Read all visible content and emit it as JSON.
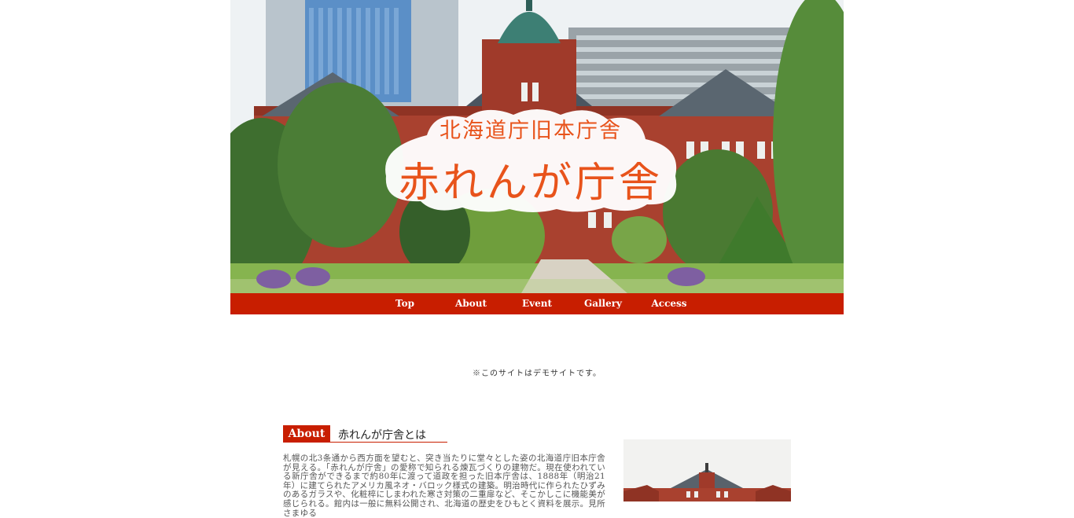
{
  "hero": {
    "subtitle": "北海道庁旧本庁舎",
    "title": "赤れんが庁舎"
  },
  "nav": {
    "items": [
      {
        "label": "Top"
      },
      {
        "label": "About"
      },
      {
        "label": "Event"
      },
      {
        "label": "Gallery"
      },
      {
        "label": "Access"
      }
    ]
  },
  "notice": "※このサイトはデモサイトです。",
  "about": {
    "tag": "About",
    "title": "赤れんが庁舎とは",
    "body": "札幌の北3条通から西方面を望むと、突き当たりに堂々とした姿の北海道庁旧本庁舎が見える。「赤れんが庁舎」の愛称で知られる煉瓦づくりの建物だ。現在使われている新庁舎ができるまで約80年に渡って道政を担った旧本庁舎は、1888年（明治21年）に建てられたアメリカ風ネオ・バロック様式の建築。明治時代に作られたひずみのあるガラスや、化粧椊にしまわれた寒さ対策の二重扉など、そこかしこに機能美が感じられる。館内は一般に無料公開され、北海道の歴史をひもとく資料を展示。見所さまゆる"
  },
  "colors": {
    "accent": "#c81e00",
    "badge_text": "#e8531b"
  }
}
